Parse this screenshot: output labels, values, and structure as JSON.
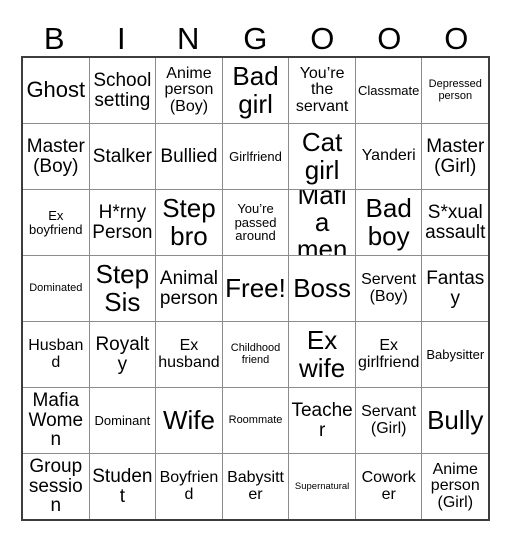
{
  "card": {
    "header_letters": [
      "B",
      "I",
      "N",
      "G",
      "O",
      "O",
      "O"
    ],
    "free_space_label": "Free!",
    "rows": [
      [
        {
          "text": "Ghost",
          "size": "xl"
        },
        {
          "text": "School setting",
          "size": "lg"
        },
        {
          "text": "Anime person (Boy)",
          "size": "md"
        },
        {
          "text": "Bad girl",
          "size": "xxl"
        },
        {
          "text": "You’re the servant",
          "size": "md"
        },
        {
          "text": "Classmate",
          "size": "sm"
        },
        {
          "text": "Depressed person",
          "size": "xs"
        }
      ],
      [
        {
          "text": "Master (Boy)",
          "size": "lg"
        },
        {
          "text": "Stalker",
          "size": "lg"
        },
        {
          "text": "Bullied",
          "size": "lg"
        },
        {
          "text": "Girlfriend",
          "size": "sm"
        },
        {
          "text": "Cat girl",
          "size": "xxl"
        },
        {
          "text": "Yanderi",
          "size": "md"
        },
        {
          "text": "Master (Girl)",
          "size": "lg"
        }
      ],
      [
        {
          "text": "Ex boyfriend",
          "size": "sm"
        },
        {
          "text": "H*rny Person",
          "size": "lg"
        },
        {
          "text": "Step bro",
          "size": "xxl"
        },
        {
          "text": "You’re passed around",
          "size": "sm"
        },
        {
          "text": "Mafia men",
          "size": "xxl"
        },
        {
          "text": "Bad boy",
          "size": "xxl"
        },
        {
          "text": "S*xual assault",
          "size": "lg"
        }
      ],
      [
        {
          "text": "Dominated",
          "size": "xs"
        },
        {
          "text": "Step Sis",
          "size": "xxl"
        },
        {
          "text": "Animal person",
          "size": "lg"
        },
        {
          "text": "Free!",
          "size": "xxl"
        },
        {
          "text": "Boss",
          "size": "xxl"
        },
        {
          "text": "Servent (Boy)",
          "size": "md"
        },
        {
          "text": "Fantasy",
          "size": "lg"
        }
      ],
      [
        {
          "text": "Husband",
          "size": "md"
        },
        {
          "text": "Royalty",
          "size": "lg"
        },
        {
          "text": "Ex husband",
          "size": "md"
        },
        {
          "text": "Childhood friend",
          "size": "xs"
        },
        {
          "text": "Ex wife",
          "size": "xxl"
        },
        {
          "text": "Ex girlfriend",
          "size": "md"
        },
        {
          "text": "Babysitter",
          "size": "sm"
        }
      ],
      [
        {
          "text": "Mafia Women",
          "size": "lg"
        },
        {
          "text": "Dominant",
          "size": "sm"
        },
        {
          "text": "Wife",
          "size": "xxl"
        },
        {
          "text": "Roommate",
          "size": "xs"
        },
        {
          "text": "Teacher",
          "size": "lg"
        },
        {
          "text": "Servant (Girl)",
          "size": "md"
        },
        {
          "text": "Bully",
          "size": "xxl"
        }
      ],
      [
        {
          "text": "Group session",
          "size": "lg"
        },
        {
          "text": "Student",
          "size": "lg"
        },
        {
          "text": "Boyfriend",
          "size": "md"
        },
        {
          "text": "Babysitter",
          "size": "md"
        },
        {
          "text": "Supernatural",
          "size": "xxs"
        },
        {
          "text": "Coworker",
          "size": "md"
        },
        {
          "text": "Anime person (Girl)",
          "size": "md"
        }
      ]
    ]
  },
  "colors": {
    "background": "#ffffff",
    "text": "#000000",
    "grid_line": "#8c8c8c",
    "outer_border": "#3d3d3d"
  }
}
